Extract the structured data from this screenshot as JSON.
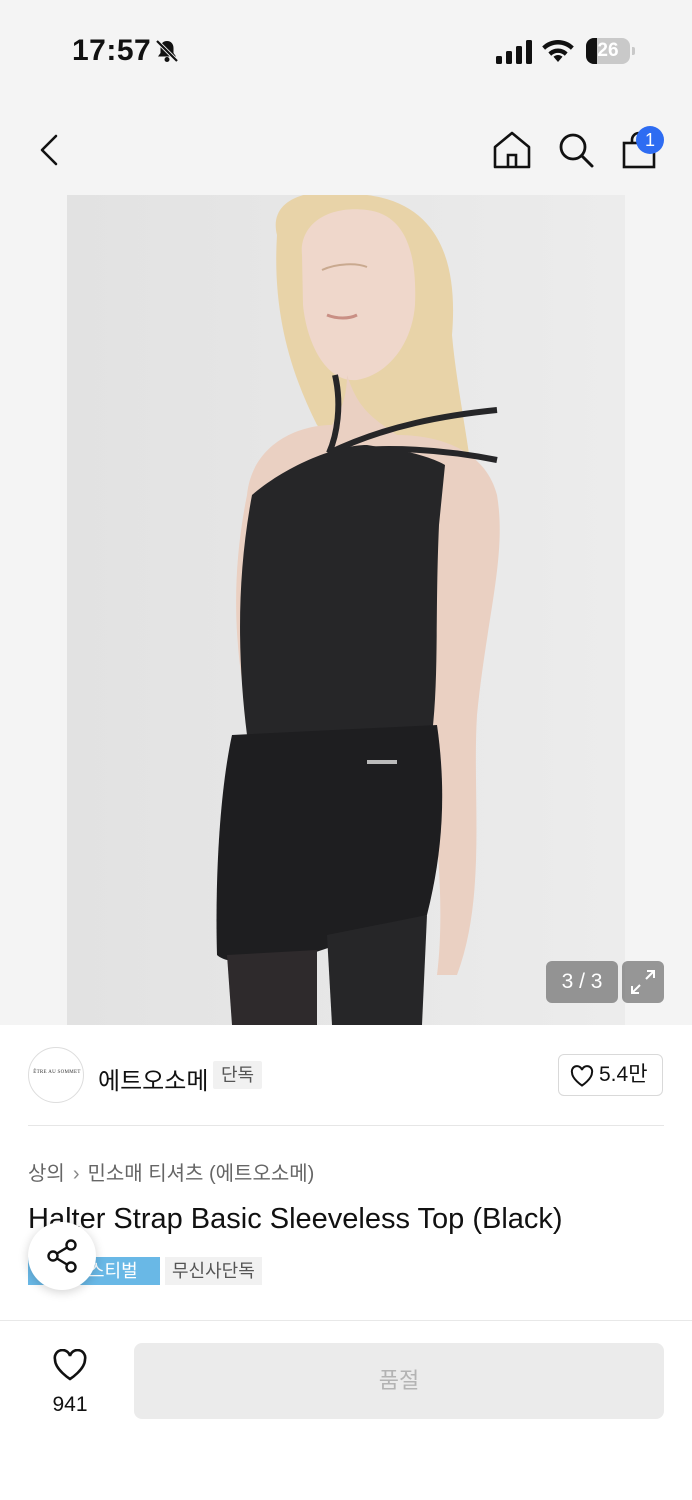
{
  "status_bar": {
    "time": "17:57",
    "battery_level": "26",
    "battery_fraction": 0.26,
    "icons": [
      "bell-slash-icon",
      "cellular-signal-icon",
      "wifi-icon",
      "battery-icon"
    ]
  },
  "nav": {
    "icons": [
      "chevron-left-icon",
      "home-icon",
      "search-icon",
      "shopping-bag-icon"
    ],
    "cart_count": "1"
  },
  "gallery": {
    "counter": "3 / 3",
    "expand_icon": "expand-icon"
  },
  "brand": {
    "logo_text": "ÊTRE AU SOMMET",
    "name": "에트오소메",
    "tag": "단독",
    "likes": "5.4만"
  },
  "product": {
    "breadcrumb": [
      "상의",
      "민소매 티셔츠 (에트오소메)"
    ],
    "title": "Halter Strap Basic Sleeveless Top (Black)",
    "tags": [
      "페스티벌",
      "무신사단독"
    ],
    "festival_tag_visible": "스티벌"
  },
  "bottom": {
    "wish_count": "941",
    "button_label": "품절"
  },
  "colors": {
    "accent_blue": "#2e6cf2",
    "festival_tag": "#69b8e6",
    "disabled_button": "#ebebeb"
  }
}
